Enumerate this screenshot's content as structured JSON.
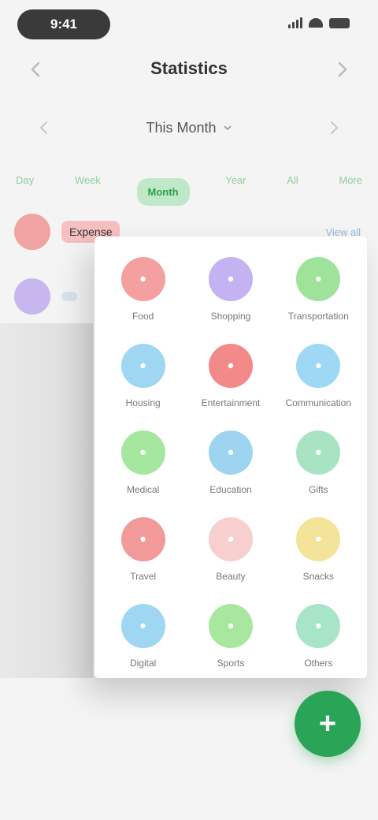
{
  "status_bar": {
    "time": "9:41"
  },
  "header": {
    "title": "Statistics"
  },
  "selector": {
    "label": "This Month"
  },
  "tabs": [
    {
      "label": "Day"
    },
    {
      "label": "Week"
    },
    {
      "label": "Month",
      "active": true
    },
    {
      "label": "Year"
    },
    {
      "label": "All"
    },
    {
      "label": "More"
    }
  ],
  "background_rows": [
    {
      "label": "Expense",
      "right": "View all",
      "color": "#f1a3a3",
      "label_bg": "#f6c0c0"
    },
    {
      "label": "",
      "right": "",
      "color": "#c8b7ef",
      "label_bg": "#d7e3ee"
    }
  ],
  "categories": [
    {
      "icon": "food-icon",
      "label": "Food",
      "color": "#f4a0a0",
      "glyph": "•"
    },
    {
      "icon": "shopping-icon",
      "label": "Shopping",
      "color": "#c5b2f2",
      "glyph": "•"
    },
    {
      "icon": "transport-icon",
      "label": "Transportation",
      "color": "#9fe29a",
      "glyph": "•"
    },
    {
      "icon": "home-icon",
      "label": "Housing",
      "color": "#9fd6f2",
      "glyph": "•"
    },
    {
      "icon": "entertainment-icon",
      "label": "Entertainment",
      "color": "#f28a8a",
      "glyph": "•"
    },
    {
      "icon": "communication-icon",
      "label": "Communication",
      "color": "#9fd8f4",
      "glyph": "•"
    },
    {
      "icon": "medical-icon",
      "label": "Medical",
      "color": "#a6e79f",
      "glyph": "•"
    },
    {
      "icon": "education-icon",
      "label": "Education",
      "color": "#9fd4f0",
      "glyph": "•"
    },
    {
      "icon": "gift-icon",
      "label": "Gifts",
      "color": "#a8e4c4",
      "glyph": "•"
    },
    {
      "icon": "travel-icon",
      "label": "Travel",
      "color": "#f29a9a",
      "glyph": "•"
    },
    {
      "icon": "beauty-icon",
      "label": "Beauty",
      "color": "#f7cfcf",
      "glyph": "•"
    },
    {
      "icon": "snack-icon",
      "label": "Snacks",
      "color": "#f4e49a",
      "glyph": "•"
    },
    {
      "icon": "digital-icon",
      "label": "Digital",
      "color": "#9fd6f2",
      "glyph": "•"
    },
    {
      "icon": "sports-icon",
      "label": "Sports",
      "color": "#a8e89e",
      "glyph": "•"
    },
    {
      "icon": "other-icon",
      "label": "Others",
      "color": "#a8e4c6",
      "glyph": "•"
    }
  ],
  "fab": {
    "label": "+"
  }
}
